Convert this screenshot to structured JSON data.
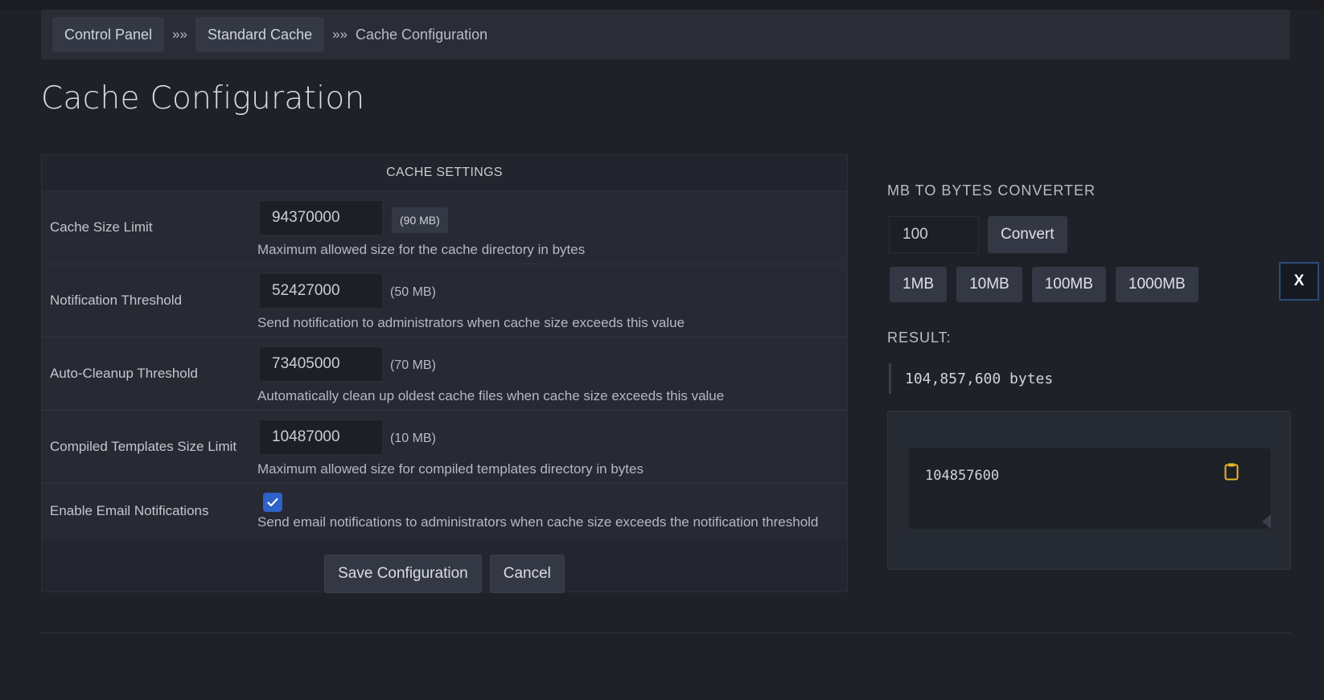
{
  "breadcrumb": {
    "items": [
      "Control Panel",
      "Standard Cache"
    ],
    "separator": "»»",
    "current": "Cache Configuration"
  },
  "page": {
    "title": "Cache Configuration"
  },
  "settings": {
    "header": "CACHE SETTINGS",
    "rows": [
      {
        "label": "Cache Size Limit",
        "value": "94370000",
        "mb": "(90 MB)",
        "help": "Maximum allowed size for the cache directory in bytes"
      },
      {
        "label": "Notification Threshold",
        "value": "52427000",
        "mb": "(50 MB)",
        "help": "Send notification to administrators when cache size exceeds this value"
      },
      {
        "label": "Auto-Cleanup Threshold",
        "value": "73405000",
        "mb": "(70 MB)",
        "help": "Automatically clean up oldest cache files when cache size exceeds this value"
      },
      {
        "label": "Compiled Templates Size Limit",
        "value": "10487000",
        "mb": "(10 MB)",
        "help": "Maximum allowed size for compiled templates directory in bytes"
      }
    ],
    "email": {
      "label": "Enable Email Notifications",
      "checked": true,
      "help": "Send email notifications to administrators when cache size exceeds the notification threshold"
    },
    "save_label": "Save Configuration",
    "cancel_label": "Cancel"
  },
  "converter": {
    "title": "MB TO BYTES CONVERTER",
    "input_value": "100",
    "convert_label": "Convert",
    "presets": [
      "1MB",
      "10MB",
      "100MB",
      "1000MB"
    ],
    "close_label": "X",
    "result_label": "RESULT:",
    "result_value": "104,857,600 bytes",
    "raw_value": "104857600"
  },
  "colors": {
    "background": "#1e2128",
    "accent": "#2d62c8",
    "clipboard_icon": "#e8b62c"
  },
  "icons": [
    "check-icon",
    "clipboard-icon",
    "resize-handle-icon"
  ]
}
